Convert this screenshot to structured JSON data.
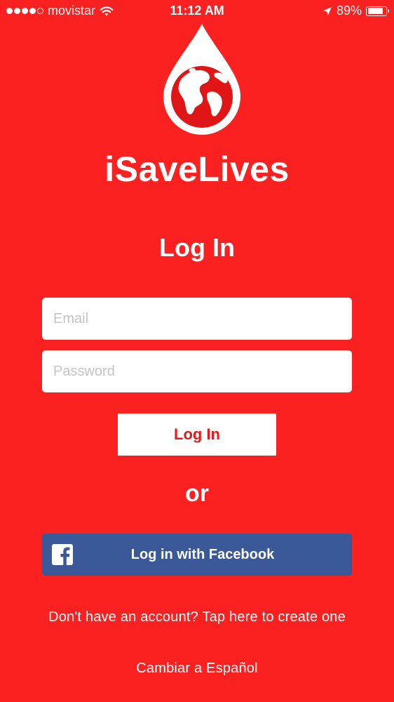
{
  "status_bar": {
    "carrier": "movistar",
    "signal_bars_filled": 4,
    "signal_bars_total": 5,
    "time": "11:12 AM",
    "battery_percent": "89%",
    "battery_level": 0.89,
    "icons": [
      "wifi-icon",
      "location-arrow-icon",
      "battery-icon"
    ]
  },
  "logo": {
    "icon": "blood-drop-globe-icon"
  },
  "app_name": "iSaveLives",
  "page_title": "Log In",
  "form": {
    "email_placeholder": "Email",
    "email_value": "",
    "password_placeholder": "Password",
    "password_value": "",
    "login_label": "Log In"
  },
  "or_label": "or",
  "facebook": {
    "label": "Log in with Facebook",
    "icon": "facebook-icon"
  },
  "signup_link": "Don't have an account? Tap here to create one",
  "language_link": "Cambiar a Español",
  "colors": {
    "background": "#fb2121",
    "facebook_blue": "#3b5998",
    "login_text": "#e51b1b",
    "globe_red": "#e01515"
  }
}
